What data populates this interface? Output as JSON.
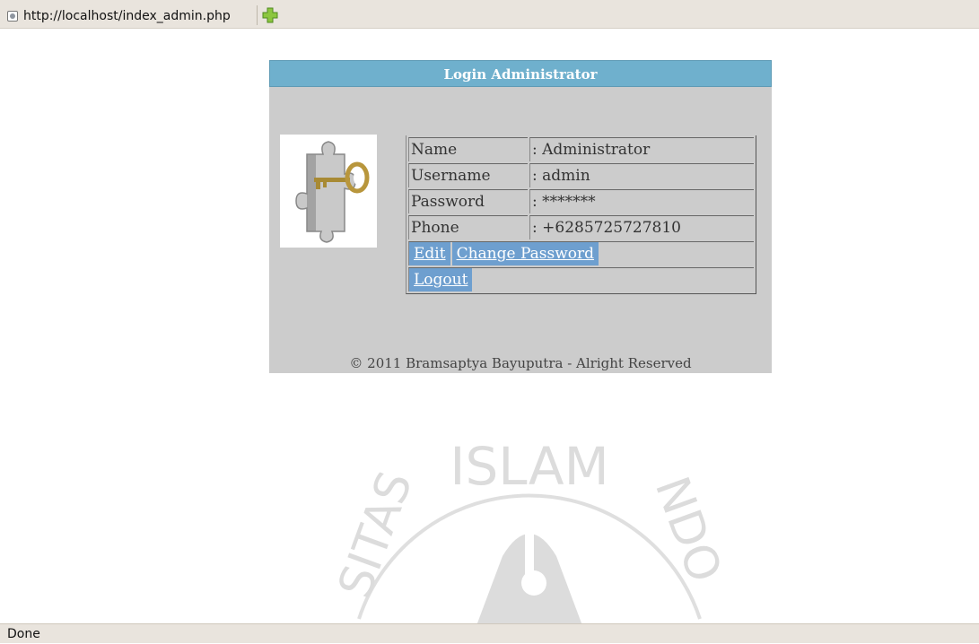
{
  "browser": {
    "tab_url": "http://localhost/index_admin.php",
    "status": "Done"
  },
  "panel": {
    "title": "Login Administrator",
    "rows": [
      {
        "label": "Name",
        "value": ": Administrator"
      },
      {
        "label": "Username",
        "value": ": admin"
      },
      {
        "label": "Password",
        "value": ": *******"
      },
      {
        "label": "Phone",
        "value": ": +6285725727810"
      }
    ],
    "edit_label": "Edit",
    "change_password_label": "Change Password",
    "logout_label": "Logout",
    "footer": "© 2011 Bramsaptya Bayuputra - Alright Reserved"
  },
  "watermark": {
    "text": "ISLAM",
    "left_text": "SITAS",
    "right_text": "NDO"
  },
  "colors": {
    "title_bar": "#6fb0cd",
    "panel_bg": "#cccccc",
    "button_bg": "#6e9fcf"
  }
}
